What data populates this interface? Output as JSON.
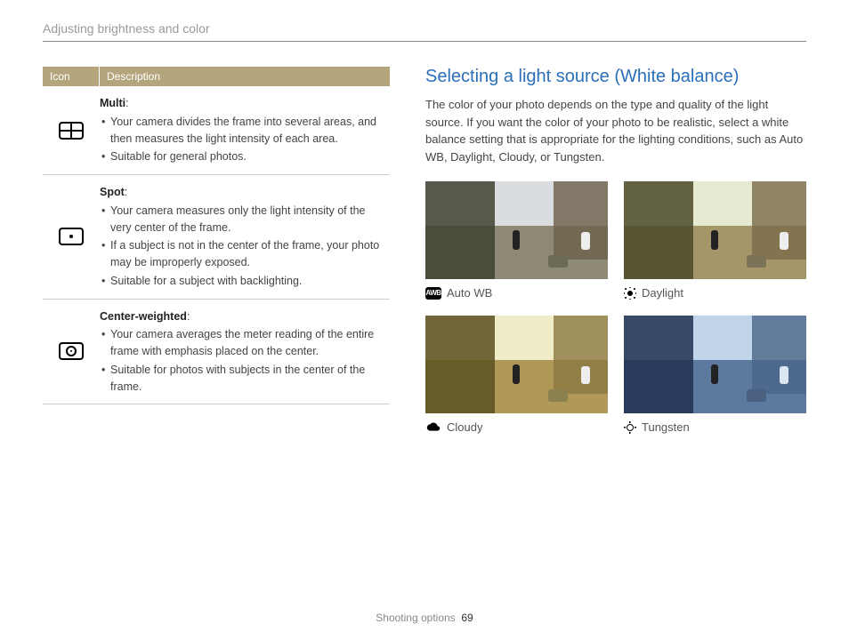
{
  "breadcrumb": "Adjusting brightness and color",
  "table": {
    "header_icon": "Icon",
    "header_desc": "Description",
    "rows": [
      {
        "name": "Multi",
        "bullets": [
          "Your camera divides the frame into several areas, and then measures the light intensity of each area.",
          "Suitable for general photos."
        ]
      },
      {
        "name": "Spot",
        "bullets": [
          "Your camera measures only the light intensity of the very center of the frame.",
          "If a subject is not in the center of the frame, your photo may be improperly exposed.",
          "Suitable for a subject with backlighting."
        ]
      },
      {
        "name": "Center-weighted",
        "bullets": [
          "Your camera averages the meter reading of the entire frame with emphasis placed on the center.",
          "Suitable for photos with subjects in the center of the frame."
        ]
      }
    ]
  },
  "right": {
    "heading": "Selecting a light source (White balance)",
    "intro": "The color of your photo depends on the type and quality of the light source. If you want the color of your photo to be realistic, select a white balance setting that is appropriate for the lighting conditions, such as Auto WB, Daylight, Cloudy, or Tungsten.",
    "thumbs": {
      "auto": "Auto WB",
      "daylight": "Daylight",
      "cloudy": "Cloudy",
      "tungsten": "Tungsten",
      "awb_badge": "AWB"
    }
  },
  "footer": {
    "section": "Shooting options",
    "page": "69"
  }
}
